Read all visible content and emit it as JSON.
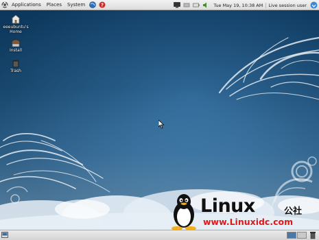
{
  "top_panel": {
    "menus": [
      "Applications",
      "Places",
      "System"
    ],
    "clock": "Tue May 19, 10:38 AM",
    "session": "Live session user"
  },
  "desktop": {
    "icons": [
      {
        "label_line1": "eeeubuntu's",
        "label_line2": "Home",
        "icon": "home-folder-icon"
      },
      {
        "label_line1": "Install",
        "icon": "installer-icon"
      },
      {
        "label_line1": "Trash",
        "icon": "trash-icon"
      }
    ]
  },
  "watermark": {
    "title": "Linux",
    "cn": "公社",
    "url": "www.Linuxidc.com"
  },
  "colors": {
    "panel": "#dcdcdc",
    "desktop_blue": "#1d5a8c",
    "url_red": "#e01818"
  }
}
